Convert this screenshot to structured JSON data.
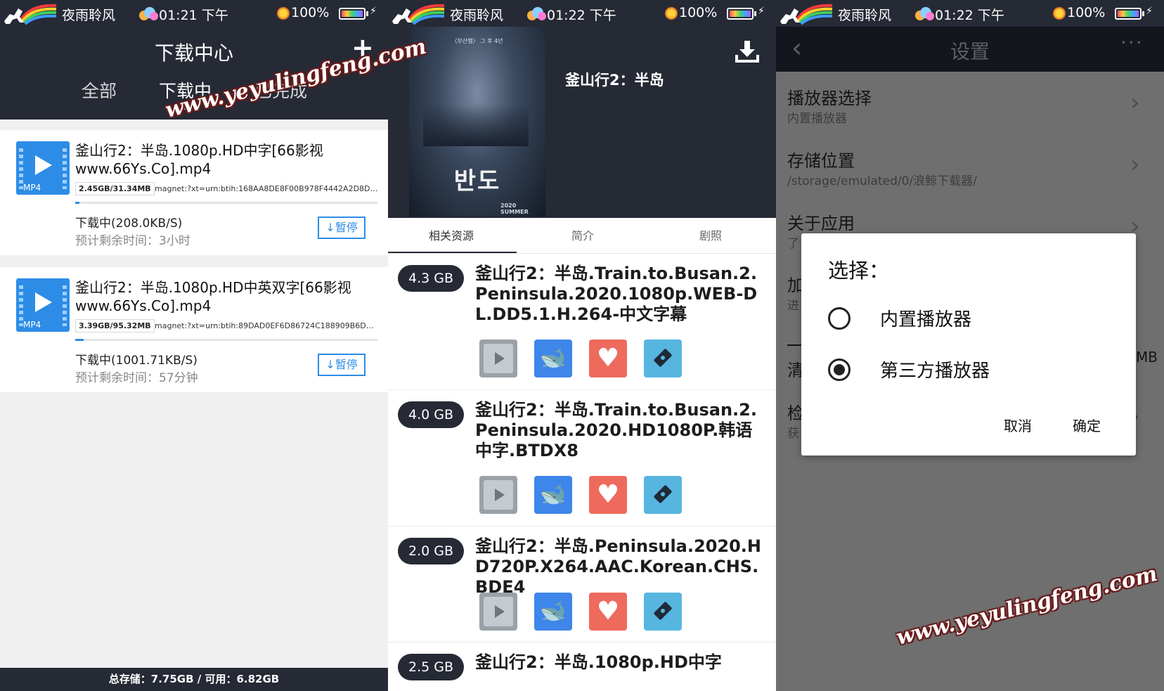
{
  "statusbar": [
    {
      "app_name": "夜雨聆风",
      "time": "01:21 下午",
      "battery": "100%"
    },
    {
      "app_name": "夜雨聆风",
      "time": "01:22 下午",
      "battery": "100%"
    },
    {
      "app_name": "夜雨聆风",
      "time": "01:22 下午",
      "battery": "100%"
    }
  ],
  "watermark": "www.yeyulingfeng.com",
  "download_center": {
    "title": "下载中心",
    "add_label": "+",
    "tabs": [
      {
        "label": "全部",
        "active": false
      },
      {
        "label": "下载中",
        "active": true
      },
      {
        "label": "已完成",
        "active": false
      }
    ],
    "items": [
      {
        "ext": "MP4",
        "name": "釜山行2：半岛.1080p.HD中字[66影视www.66Ys.Co].mp4",
        "size": "2.45GB/31.34MB",
        "magnet": "magnet:?xt=urn:btih:168AA8DE8F00B978F4442A2D8D40...",
        "progress": 0.013,
        "status": "下载中(208.0KB/S)",
        "eta": "预计剩余时间：3小时",
        "pause_label": "暂停"
      },
      {
        "ext": "MP4",
        "name": "釜山行2：半岛.1080p.HD中英双字[66影视www.66Ys.Co].mp4",
        "size": "3.39GB/95.32MB",
        "magnet": "magnet:?xt=urn:btih:89DAD0EF6D86724C188909B6D1C...",
        "progress": 0.028,
        "status": "下载中(1001.71KB/S)",
        "eta": "预计剩余时间：57分钟",
        "pause_label": "暂停"
      }
    ],
    "footer": "总存储：7.75GB / 可用：6.82GB"
  },
  "movie": {
    "poster": {
      "top_text": "〈부산행〉 그 후 4년",
      "title": "반도",
      "bottom_text": "2020 SUMMER"
    },
    "title": "釜山行2：半岛",
    "tabs": [
      {
        "label": "相关资源",
        "active": true
      },
      {
        "label": "简介",
        "active": false
      },
      {
        "label": "剧照",
        "active": false
      }
    ],
    "resources": [
      {
        "size": "4.3 GB",
        "title": "釜山行2：半岛.Train.to.Busan.2.Peninsula.2020.1080p.WEB-DL.DD5.1.H.264-中文字幕"
      },
      {
        "size": "4.0 GB",
        "title": "釜山行2：半岛.Train.to.Busan.2.Peninsula.2020.HD1080P.韩语中字.BTDX8"
      },
      {
        "size": "2.0 GB",
        "title": "釜山行2：半岛.Peninsula.2020.HD720P.X264.AAC.Korean.CHS.BDE4"
      },
      {
        "size": "2.5 GB",
        "title": "釜山行2：半岛.1080p.HD中字"
      }
    ]
  },
  "settings": {
    "title": "设置",
    "back_icon": "‹",
    "more_icon": "···",
    "rows": [
      {
        "title": "播放器选择",
        "sub": "内置播放器"
      },
      {
        "title": "存储位置",
        "sub": "/storage/emulated/0/浪鲸下载器/"
      },
      {
        "title": "关于应用",
        "sub": "了"
      },
      {
        "title": "加",
        "sub": "进"
      },
      {
        "title": "清",
        "sub": "MB"
      },
      {
        "title": "检",
        "sub": "获"
      }
    ],
    "dialog": {
      "title": "选择：",
      "options": [
        {
          "label": "内置播放器",
          "checked": false
        },
        {
          "label": "第三方播放器",
          "checked": true
        }
      ],
      "cancel": "取消",
      "ok": "确定"
    }
  }
}
